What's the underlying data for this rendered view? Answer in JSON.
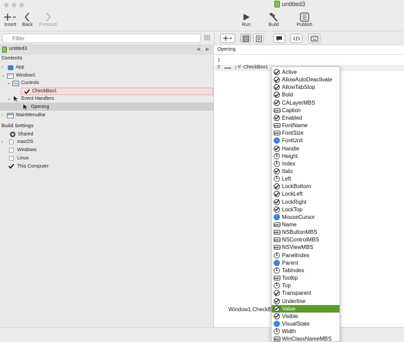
{
  "toolbar": {
    "insert_label": "Insert",
    "back_label": "Back",
    "forward_label": "Forward",
    "run_label": "Run",
    "build_label": "Build",
    "publish_label": "Publish",
    "document_title": "untitled3"
  },
  "filter": {
    "placeholder": "Filter"
  },
  "navigator": {
    "title": "untitled3",
    "contents_heading": "Contents",
    "items": {
      "app": "App",
      "window1": "Window1",
      "controls": "Controls",
      "checkbox1": "CheckBox1",
      "event_handlers": "Event Handlers",
      "opening": "Opening",
      "mainmenubar": "MainMenuBar"
    },
    "build_settings_heading": "Build Settings",
    "build_settings": [
      {
        "label": "Shared",
        "checked": false
      },
      {
        "label": "macOS",
        "checked": false
      },
      {
        "label": "Windows",
        "checked": false
      },
      {
        "label": "Linux",
        "checked": false
      },
      {
        "label": "This Computer",
        "checked": true
      }
    ]
  },
  "editor": {
    "breadcrumb": "Opening",
    "line_numbers": [
      "1",
      "2"
    ],
    "code_keyword": "If",
    "code_text": "CheckBox1",
    "bottom_code": "Window1.CheckB"
  },
  "autocomplete": {
    "selected": "Value",
    "items": [
      {
        "label": "Active",
        "kind": "bool"
      },
      {
        "label": "AllowAutoDeactivate",
        "kind": "bool"
      },
      {
        "label": "AllowTabStop",
        "kind": "bool"
      },
      {
        "label": "Bold",
        "kind": "bool"
      },
      {
        "label": "CALayerMBS",
        "kind": "bool"
      },
      {
        "label": "Caption",
        "kind": "string"
      },
      {
        "label": "Enabled",
        "kind": "bool"
      },
      {
        "label": "FontName",
        "kind": "string"
      },
      {
        "label": "FontSize",
        "kind": "string"
      },
      {
        "label": "FontUnit",
        "kind": "enum"
      },
      {
        "label": "Handle",
        "kind": "bool"
      },
      {
        "label": "Height",
        "kind": "number"
      },
      {
        "label": "Index",
        "kind": "number"
      },
      {
        "label": "Italic",
        "kind": "bool"
      },
      {
        "label": "Left",
        "kind": "number"
      },
      {
        "label": "LockBottom",
        "kind": "bool"
      },
      {
        "label": "LockLeft",
        "kind": "bool"
      },
      {
        "label": "LockRight",
        "kind": "bool"
      },
      {
        "label": "LockTop",
        "kind": "bool"
      },
      {
        "label": "MouseCursor",
        "kind": "enum"
      },
      {
        "label": "Name",
        "kind": "string"
      },
      {
        "label": "NSButtonMBS",
        "kind": "string"
      },
      {
        "label": "NSControlMBS",
        "kind": "string"
      },
      {
        "label": "NSViewMBS",
        "kind": "string"
      },
      {
        "label": "PanelIndex",
        "kind": "number"
      },
      {
        "label": "Parent",
        "kind": "enum"
      },
      {
        "label": "TabIndex",
        "kind": "number"
      },
      {
        "label": "Tooltip",
        "kind": "string"
      },
      {
        "label": "Top",
        "kind": "number"
      },
      {
        "label": "Transparent",
        "kind": "bool"
      },
      {
        "label": "Underline",
        "kind": "bool"
      },
      {
        "label": "Value",
        "kind": "bool"
      },
      {
        "label": "Visible",
        "kind": "bool"
      },
      {
        "label": "VisualState",
        "kind": "enum"
      },
      {
        "label": "Width",
        "kind": "number"
      },
      {
        "label": "WinClassNameMBS",
        "kind": "string"
      }
    ]
  },
  "colors": {
    "selection_green": "#5a9c2a",
    "selected_control_bg": "#f4dcdc",
    "enum_blue": "#3d8ae6"
  }
}
